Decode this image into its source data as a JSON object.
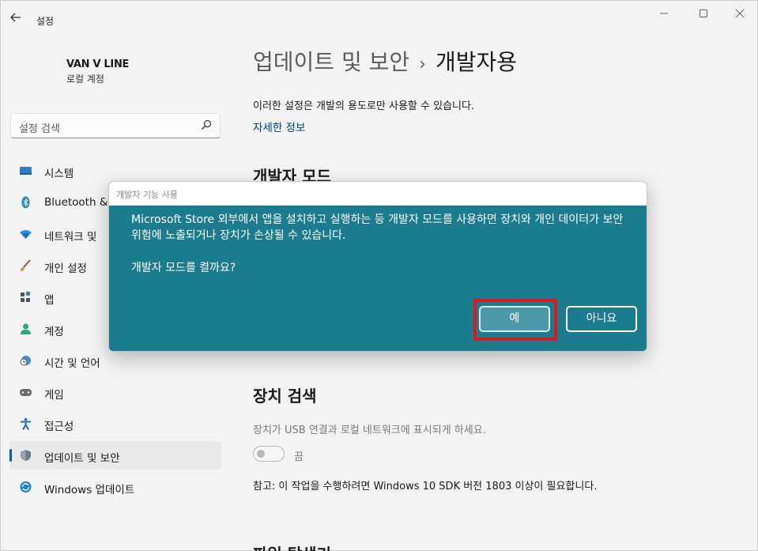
{
  "window": {
    "app_title": "설정",
    "controls": {
      "minimize": "—",
      "maximize": "☐",
      "close": "✕"
    }
  },
  "profile": {
    "name": "VAN V LINE",
    "account_type": "로컬 계정"
  },
  "search": {
    "placeholder": "설정 검색"
  },
  "sidebar": {
    "items": [
      {
        "label": "시스템",
        "icon": "system-icon"
      },
      {
        "label": "Bluetooth &",
        "icon": "bluetooth-icon"
      },
      {
        "label": "네트워크 및",
        "icon": "network-icon"
      },
      {
        "label": "개인 설정",
        "icon": "personalization-icon"
      },
      {
        "label": "앱",
        "icon": "apps-icon"
      },
      {
        "label": "계정",
        "icon": "accounts-icon"
      },
      {
        "label": "시간 및 언어",
        "icon": "time-language-icon"
      },
      {
        "label": "게임",
        "icon": "gaming-icon"
      },
      {
        "label": "접근성",
        "icon": "accessibility-icon"
      },
      {
        "label": "업데이트 및 보안",
        "icon": "shield-icon",
        "active": true
      },
      {
        "label": "Windows 업데이트",
        "icon": "windows-update-icon"
      }
    ]
  },
  "main": {
    "breadcrumb_parent": "업데이트 및 보안",
    "breadcrumb_separator": "›",
    "page_title": "개발자용",
    "intro": "이러한 설정은 개발의 용도로만 사용할 수 있습니다.",
    "more_info_link": "자세한 정보",
    "dev_mode_title": "개발자 모드",
    "device_discovery_title": "장치 검색",
    "device_discovery_desc": "장치가 USB 연결과 로컬 네트워크에 표시되게 하세요.",
    "toggle_state": "끔",
    "note": "참고: 이 작업을 수행하려면 Windows 10 SDK 버전 1803 이상이 필요합니다.",
    "file_explorer_title": "파일 탐색기"
  },
  "dialog": {
    "title": "개발자 기능 사용",
    "body": "Microsoft Store 외부에서 앱을 설치하고 실행하는 등 개발자 모드를 사용하면 장치와 개인 데이터가 보안 위험에 노출되거나 장치가 손상될 수 있습니다.",
    "question": "개발자 모드를 켤까요?",
    "yes_label": "예",
    "no_label": "아니요"
  },
  "colors": {
    "dialog_bg": "#1b7b8f",
    "highlight": "#e0191f",
    "accent": "#005fb8",
    "link": "#003e92"
  }
}
